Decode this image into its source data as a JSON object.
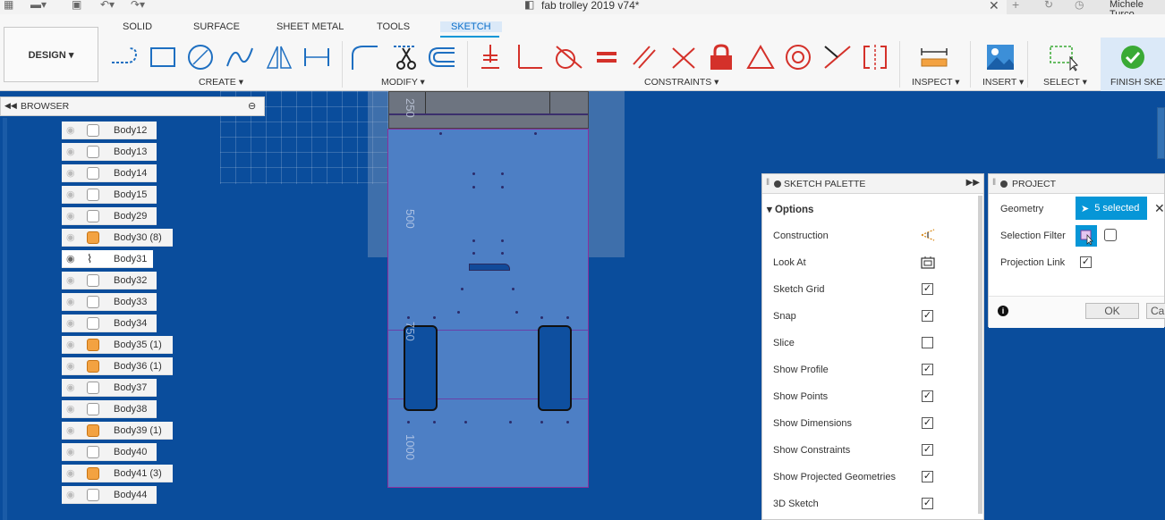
{
  "window": {
    "title": "fab trolley 2019 v74*",
    "user": "Michele Turco"
  },
  "toolbar": {
    "design_label": "DESIGN ▾",
    "tabs": [
      "SOLID",
      "SURFACE",
      "SHEET METAL",
      "TOOLS",
      "SKETCH"
    ],
    "active_tab": "SKETCH",
    "groups": {
      "create": "CREATE ▾",
      "modify": "MODIFY ▾",
      "constraints": "CONSTRAINTS ▾",
      "inspect": "INSPECT ▾",
      "insert": "INSERT ▾",
      "select": "SELECT ▾",
      "finish": "FINISH SKETCH"
    }
  },
  "browser": {
    "title": "BROWSER",
    "items": [
      {
        "name": "Body12",
        "icon": "body-icon"
      },
      {
        "name": "Body13",
        "icon": "body-icon"
      },
      {
        "name": "Body14",
        "icon": "body-icon"
      },
      {
        "name": "Body15",
        "icon": "body-icon"
      },
      {
        "name": "Body29",
        "icon": "body-icon"
      },
      {
        "name": "Body30 (8)",
        "icon": "component-icon"
      },
      {
        "name": "Body31",
        "icon": "sketch-body-icon"
      },
      {
        "name": "Body32",
        "icon": "body-icon"
      },
      {
        "name": "Body33",
        "icon": "body-icon"
      },
      {
        "name": "Body34",
        "icon": "body-icon"
      },
      {
        "name": "Body35 (1)",
        "icon": "component-icon"
      },
      {
        "name": "Body36 (1)",
        "icon": "component-icon"
      },
      {
        "name": "Body37",
        "icon": "body-icon"
      },
      {
        "name": "Body38",
        "icon": "body-icon"
      },
      {
        "name": "Body39 (1)",
        "icon": "component-icon"
      },
      {
        "name": "Body40",
        "icon": "body-icon"
      },
      {
        "name": "Body41 (3)",
        "icon": "component-icon"
      },
      {
        "name": "Body44",
        "icon": "body-icon"
      }
    ]
  },
  "canvas": {
    "dimensions": [
      "250",
      "500",
      "750",
      "1000"
    ]
  },
  "sketch_palette": {
    "title": "SKETCH PALETTE",
    "section": "Options",
    "options": [
      {
        "label": "Construction",
        "type": "icon",
        "icon": "construction-icon"
      },
      {
        "label": "Look At",
        "type": "icon",
        "icon": "look-at-icon"
      },
      {
        "label": "Sketch Grid",
        "type": "checkbox",
        "checked": true
      },
      {
        "label": "Snap",
        "type": "checkbox",
        "checked": true
      },
      {
        "label": "Slice",
        "type": "checkbox",
        "checked": false
      },
      {
        "label": "Show Profile",
        "type": "checkbox",
        "checked": true
      },
      {
        "label": "Show Points",
        "type": "checkbox",
        "checked": true
      },
      {
        "label": "Show Dimensions",
        "type": "checkbox",
        "checked": true
      },
      {
        "label": "Show Constraints",
        "type": "checkbox",
        "checked": true
      },
      {
        "label": "Show Projected Geometries",
        "type": "checkbox",
        "checked": true
      },
      {
        "label": "3D Sketch",
        "type": "checkbox",
        "checked": true
      }
    ]
  },
  "project": {
    "title": "PROJECT",
    "geometry_label": "Geometry",
    "geometry_value": "5 selected",
    "selection_filter_label": "Selection Filter",
    "projection_link_label": "Projection Link",
    "projection_link_checked": true,
    "ok": "OK",
    "cancel": "Cancel"
  },
  "colors": {
    "canvas": "#0a4d9c",
    "accent": "#0696d7",
    "finish": "#3aaa35",
    "constraint_red": "#d4312a"
  }
}
